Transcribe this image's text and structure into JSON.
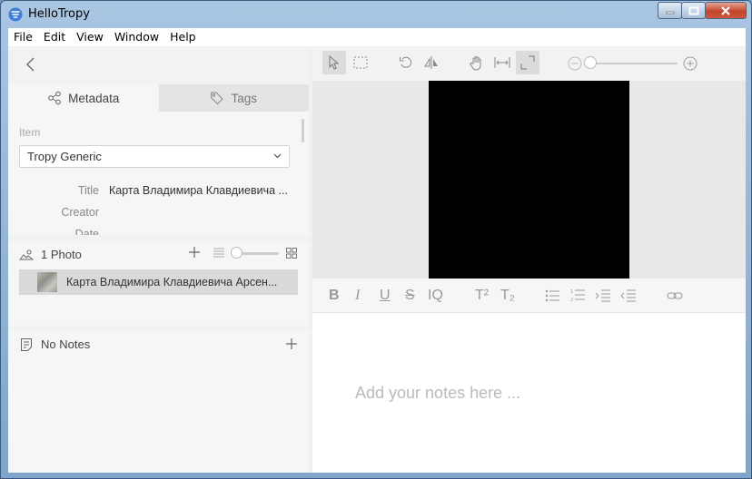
{
  "window": {
    "title": "HelloTropy"
  },
  "menu": [
    "File",
    "Edit",
    "View",
    "Window",
    "Help"
  ],
  "tabs": {
    "metadata": "Metadata",
    "tags": "Tags"
  },
  "metadata": {
    "item_label": "Item",
    "template": "Tropy Generic",
    "fields": [
      {
        "label": "Title",
        "value": "Карта Владимира Клавдиевича ..."
      },
      {
        "label": "Creator",
        "value": ""
      },
      {
        "label": "Date",
        "value": ""
      }
    ]
  },
  "photos": {
    "count_label": "1 Photo",
    "items": [
      {
        "title": "Карта Владимира Клавдиевича Арсен..."
      }
    ]
  },
  "notes": {
    "label": "No Notes",
    "placeholder": "Add your notes here ..."
  },
  "editor": {
    "bold": "B",
    "italic": "I",
    "underline": "U",
    "strike": "S",
    "quote": "IQ",
    "superscript": "T²",
    "subscript": "T₂"
  }
}
